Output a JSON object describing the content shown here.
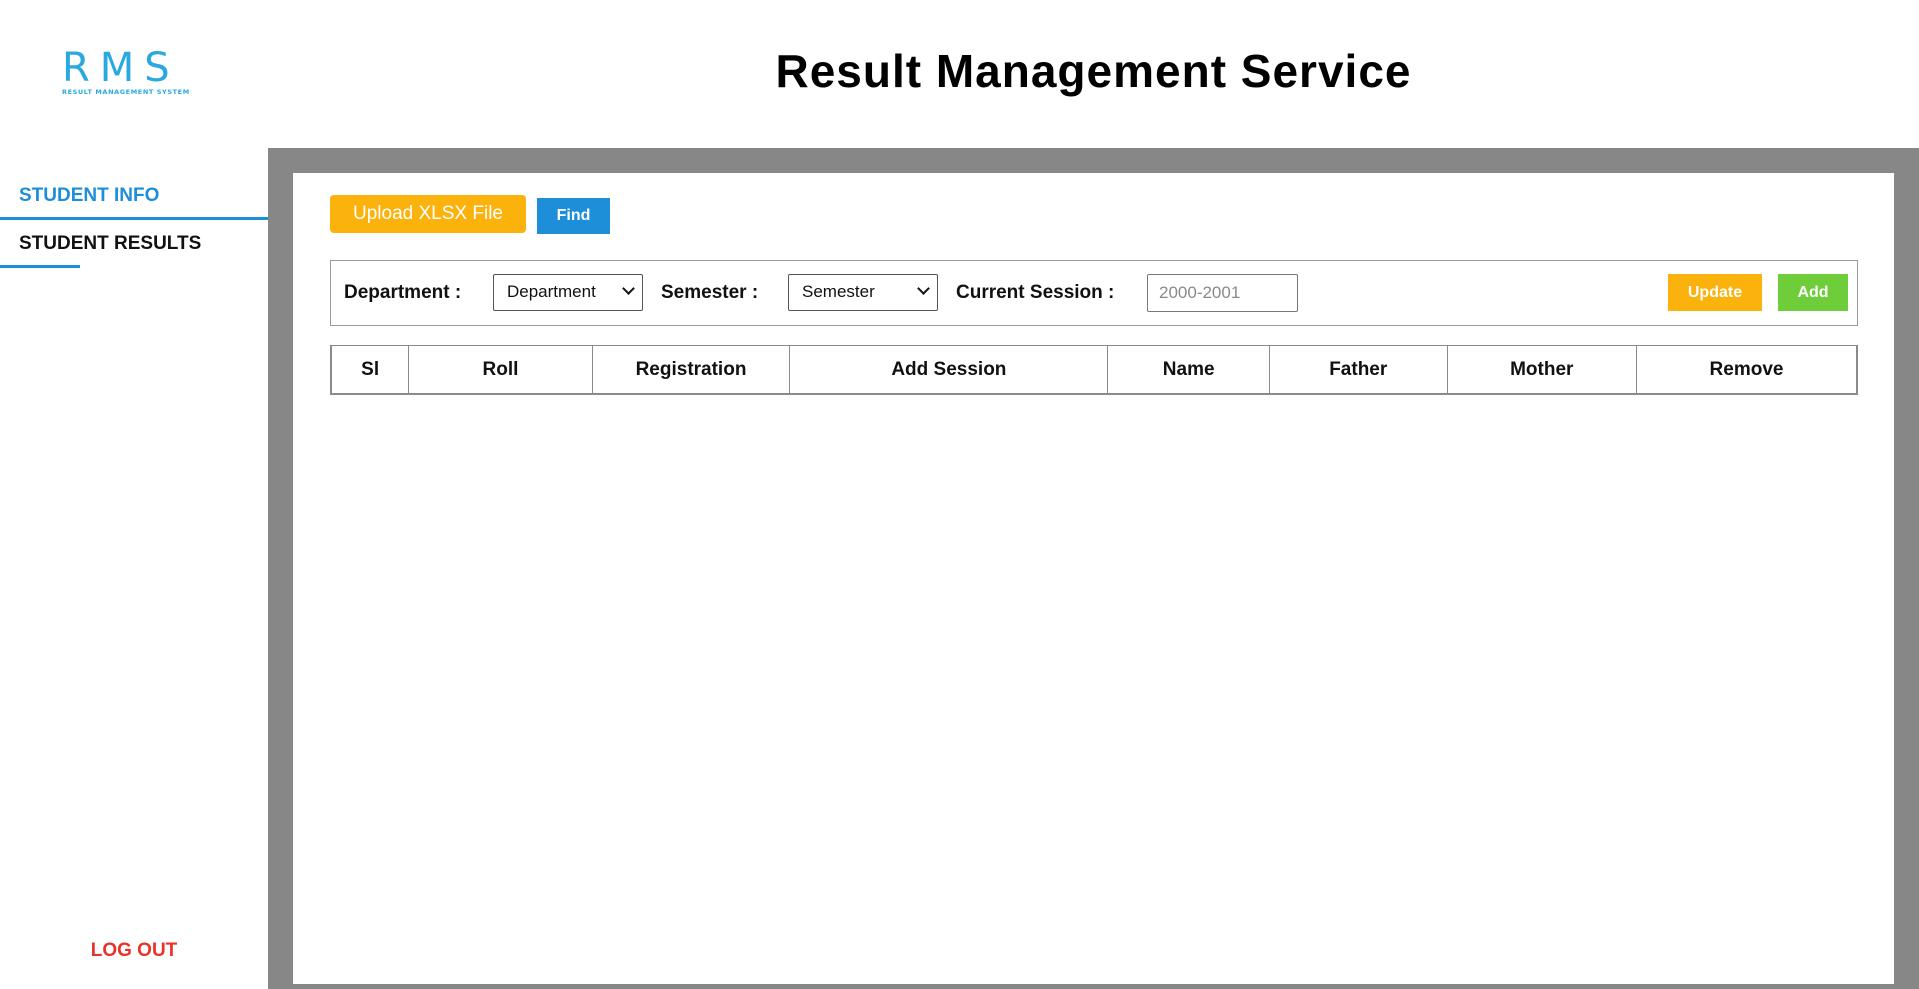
{
  "logo": {
    "main": "RMS",
    "sub": "RESULT MANAGEMENT SYSTEM"
  },
  "header": {
    "title": "Result Management Service"
  },
  "sidebar": {
    "items": [
      {
        "label": "STUDENT INFO",
        "active": true
      },
      {
        "label": "STUDENT RESULTS",
        "active": false
      }
    ],
    "logout_label": "LOG OUT"
  },
  "toolbar": {
    "upload_label": "Upload XLSX File",
    "find_label": "Find"
  },
  "filters": {
    "department_label": "Department :",
    "department_value": "Department",
    "semester_label": "Semester :",
    "semester_value": "Semester",
    "session_label": "Current Session :",
    "session_placeholder": "2000-2001",
    "update_label": "Update",
    "add_label": "Add"
  },
  "table": {
    "columns": [
      "Sl",
      "Roll",
      "Registration",
      "Add Session",
      "Name",
      "Father",
      "Mother",
      "Remove"
    ],
    "rows": []
  },
  "colors": {
    "accent": "#1d8fd8",
    "warning": "#fbb20d",
    "success": "#6fcd3a",
    "danger": "#e8332a",
    "frame": "#878787"
  }
}
